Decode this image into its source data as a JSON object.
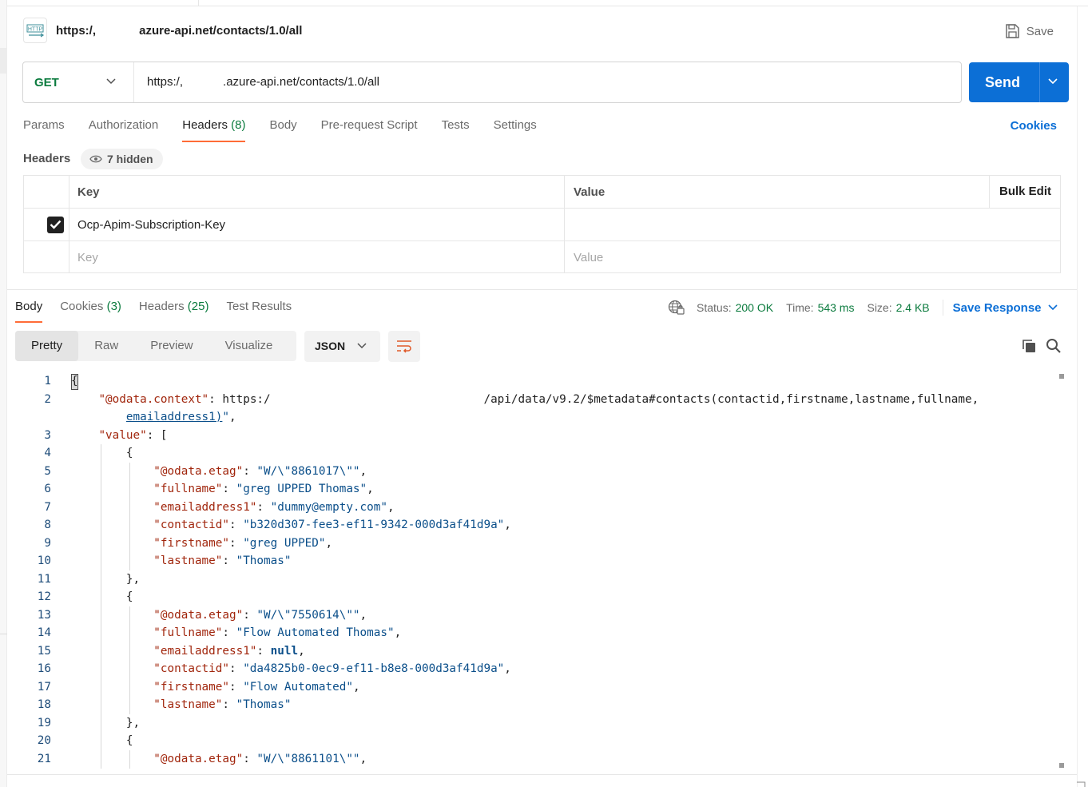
{
  "request": {
    "name": "https:/,             azure-api.net/contacts/1.0/all",
    "method": "GET",
    "url": "https:/,            .azure-api.net/contacts/1.0/all",
    "save_label": "Save",
    "send_label": "Send",
    "http_icon_text": "HTTP"
  },
  "request_tabs": [
    {
      "label": "Params"
    },
    {
      "label": "Authorization"
    },
    {
      "label": "Headers",
      "count": "(8)"
    },
    {
      "label": "Body"
    },
    {
      "label": "Pre-request Script"
    },
    {
      "label": "Tests"
    },
    {
      "label": "Settings"
    }
  ],
  "cookies_link": "Cookies",
  "headers_section": {
    "label": "Headers",
    "hidden_pill": "7 hidden",
    "key_header": "Key",
    "value_header": "Value",
    "bulk_edit": "Bulk Edit",
    "rows": [
      {
        "checked": true,
        "key": "Ocp-Apim-Subscription-Key",
        "value": ""
      }
    ],
    "key_placeholder": "Key",
    "value_placeholder": "Value"
  },
  "response_tabs": [
    {
      "label": "Body"
    },
    {
      "label": "Cookies",
      "count": "(3)"
    },
    {
      "label": "Headers",
      "count": "(25)"
    },
    {
      "label": "Test Results"
    }
  ],
  "response_meta": {
    "status_label": "Status:",
    "status_value": "200 OK",
    "time_label": "Time:",
    "time_value": "543 ms",
    "size_label": "Size:",
    "size_value": "2.4 KB",
    "save_response": "Save Response"
  },
  "view_modes": [
    "Pretty",
    "Raw",
    "Preview",
    "Visualize"
  ],
  "format": "JSON",
  "colors": {
    "accent_orange": "#ff6c37",
    "primary_blue": "#0c6fd6",
    "success_green": "#0b7b3e",
    "json_key": "#a1260d",
    "json_string": "#0b4f8a"
  },
  "code_lines": [
    {
      "n": "1",
      "text": "{"
    },
    {
      "n": "2",
      "text": "    \"@odata.context\": \"https:/                               /api/data/v9.2/$metadata#contacts(contactid,firstname,lastname,fullname,"
    },
    {
      "n": "",
      "text": "        emailaddress1)\","
    },
    {
      "n": "3",
      "text": "    \"value\": ["
    },
    {
      "n": "4",
      "text": "        {"
    },
    {
      "n": "5",
      "text": "            \"@odata.etag\": \"W/\\\"8861017\\\"\","
    },
    {
      "n": "6",
      "text": "            \"fullname\": \"greg UPPED Thomas\","
    },
    {
      "n": "7",
      "text": "            \"emailaddress1\": \"dummy@empty.com\","
    },
    {
      "n": "8",
      "text": "            \"contactid\": \"b320d307-fee3-ef11-9342-000d3af41d9a\","
    },
    {
      "n": "9",
      "text": "            \"firstname\": \"greg UPPED\","
    },
    {
      "n": "10",
      "text": "            \"lastname\": \"Thomas\""
    },
    {
      "n": "11",
      "text": "        },"
    },
    {
      "n": "12",
      "text": "        {"
    },
    {
      "n": "13",
      "text": "            \"@odata.etag\": \"W/\\\"7550614\\\"\","
    },
    {
      "n": "14",
      "text": "            \"fullname\": \"Flow Automated Thomas\","
    },
    {
      "n": "15",
      "text": "            \"emailaddress1\": null,"
    },
    {
      "n": "16",
      "text": "            \"contactid\": \"da4825b0-0ec9-ef11-b8e8-000d3af41d9a\","
    },
    {
      "n": "17",
      "text": "            \"firstname\": \"Flow Automated\","
    },
    {
      "n": "18",
      "text": "            \"lastname\": \"Thomas\""
    },
    {
      "n": "19",
      "text": "        },"
    },
    {
      "n": "20",
      "text": "        {"
    },
    {
      "n": "21",
      "text": "            \"@odata.etag\": \"W/\\\"8861101\\\"\","
    }
  ]
}
